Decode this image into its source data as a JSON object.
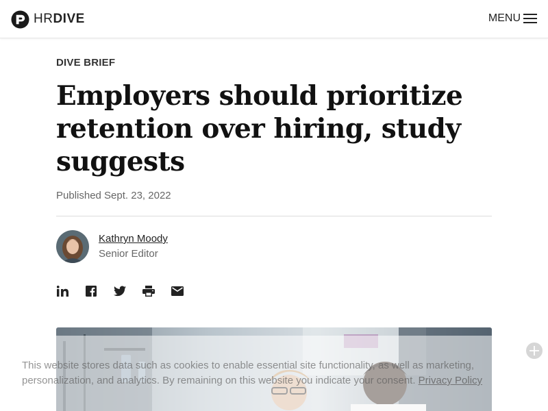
{
  "header": {
    "logo": {
      "hr": "HR",
      "dive": "DIVE"
    },
    "menu_label": "MENU"
  },
  "article": {
    "eyebrow": "DIVE BRIEF",
    "title": "Employers should prioritize retention over hiring, study suggests",
    "published": "Published Sept. 23, 2022",
    "author": {
      "name": "Kathryn Moody",
      "role": "Senior Editor"
    },
    "share": [
      "linkedin-icon",
      "facebook-icon",
      "twitter-icon",
      "print-icon",
      "email-icon"
    ]
  },
  "cookie_banner": {
    "text": "This website stores data such as cookies to enable essential site functionality, as well as marketing, personalization, and analytics. By remaining on this website you indicate your consent.",
    "link": "Privacy Policy"
  },
  "colors": {
    "text": "#111111",
    "muted": "#666666",
    "divider": "#dcdcdc"
  }
}
